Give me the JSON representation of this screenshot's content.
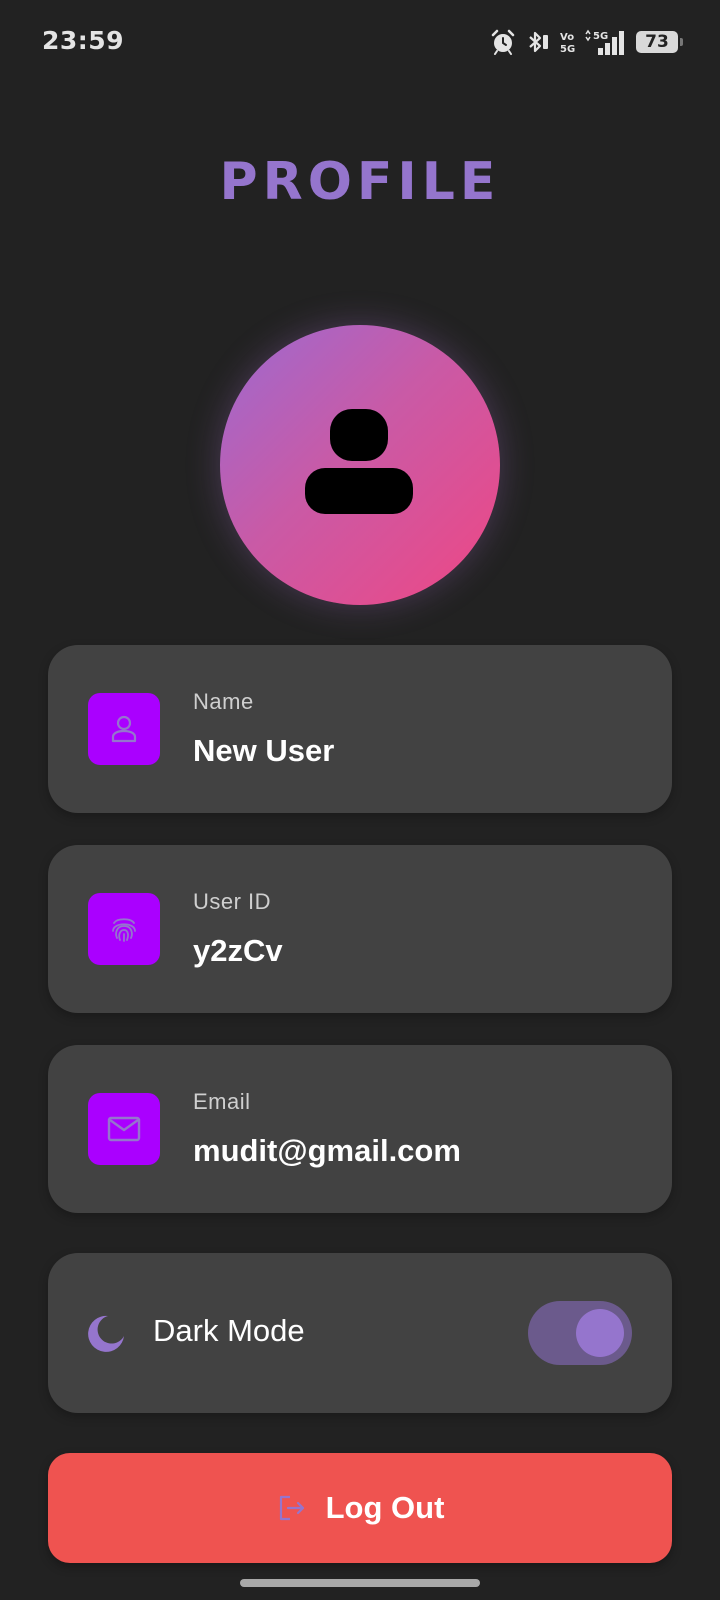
{
  "status_bar": {
    "time": "23:59",
    "battery": "73",
    "network_label": "5G",
    "volte_label": "Vo 5G",
    "icons": [
      "alarm-icon",
      "bluetooth-icon",
      "volte-icon",
      "signal-icon",
      "battery-icon"
    ]
  },
  "page": {
    "title": "PROFILE"
  },
  "avatar": {
    "icon": "person-icon",
    "gradient": [
      "#9c6ad1",
      "#ef4784"
    ]
  },
  "profile_fields": [
    {
      "label": "Name",
      "value": "New User",
      "icon": "person-icon"
    },
    {
      "label": "User ID",
      "value": "y2zCv",
      "icon": "fingerprint-icon"
    },
    {
      "label": "Email",
      "value": "mudit@gmail.com",
      "icon": "mail-icon"
    }
  ],
  "settings": {
    "dark_mode": {
      "label": "Dark Mode",
      "icon": "moon-icon",
      "enabled": true
    }
  },
  "actions": {
    "logout_label": "Log Out",
    "logout_icon": "logout-icon"
  },
  "colors": {
    "background": "#222222",
    "card": "#424242",
    "accent": "#9575cd",
    "icon_box": "#aa00ff",
    "logout": "#ef5350"
  }
}
